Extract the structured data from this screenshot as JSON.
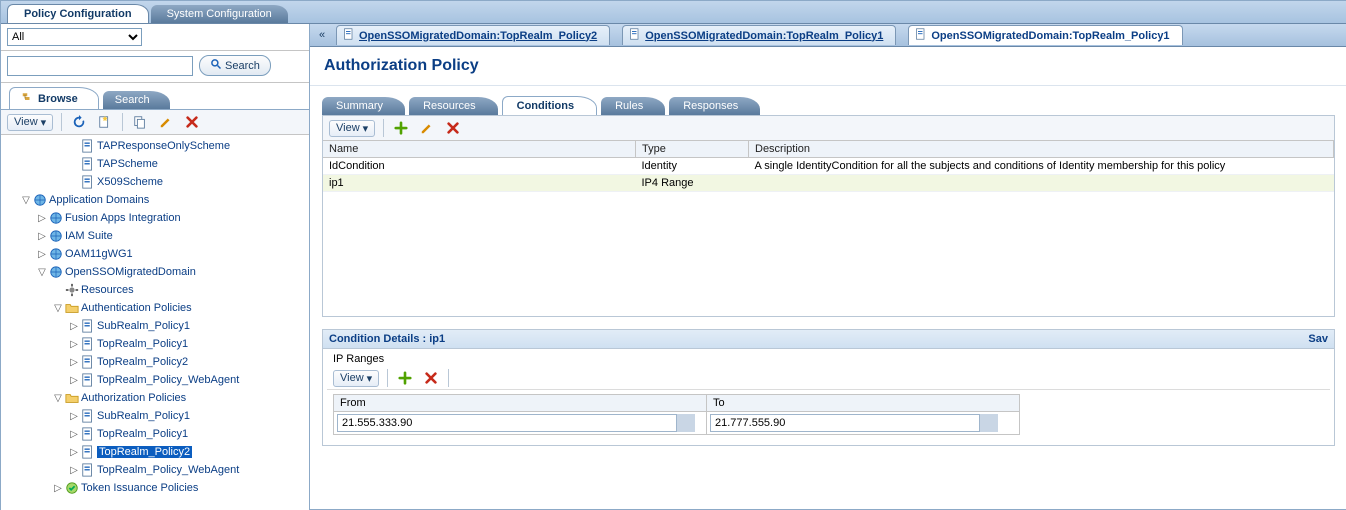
{
  "top_tabs": {
    "active": "Policy Configuration",
    "items": [
      "Policy Configuration",
      "System Configuration"
    ]
  },
  "left": {
    "all_select": "All",
    "search_btn": "Search",
    "browse_tab": "Browse",
    "search_tab": "Search",
    "view_label": "View"
  },
  "tree": [
    {
      "depth": 3,
      "toggle": "",
      "icon": "doc",
      "label": "TAPResponseOnlyScheme"
    },
    {
      "depth": 3,
      "toggle": "",
      "icon": "doc",
      "label": "TAPScheme"
    },
    {
      "depth": 3,
      "toggle": "",
      "icon": "doc",
      "label": "X509Scheme"
    },
    {
      "depth": 0,
      "toggle": "▽",
      "icon": "globe",
      "label": "Application Domains"
    },
    {
      "depth": 1,
      "toggle": "▷",
      "icon": "globe",
      "label": "Fusion Apps Integration"
    },
    {
      "depth": 1,
      "toggle": "▷",
      "icon": "globe",
      "label": "IAM Suite"
    },
    {
      "depth": 1,
      "toggle": "▷",
      "icon": "globe",
      "label": "OAM11gWG1"
    },
    {
      "depth": 1,
      "toggle": "▽",
      "icon": "globe",
      "label": "OpenSSOMigratedDomain"
    },
    {
      "depth": 2,
      "toggle": "",
      "icon": "gear",
      "label": "Resources"
    },
    {
      "depth": 2,
      "toggle": "▽",
      "icon": "folder",
      "label": "Authentication Policies"
    },
    {
      "depth": 3,
      "toggle": "▷",
      "icon": "doc",
      "label": "SubRealm_Policy1"
    },
    {
      "depth": 3,
      "toggle": "▷",
      "icon": "doc",
      "label": "TopRealm_Policy1"
    },
    {
      "depth": 3,
      "toggle": "▷",
      "icon": "doc",
      "label": "TopRealm_Policy2"
    },
    {
      "depth": 3,
      "toggle": "▷",
      "icon": "doc",
      "label": "TopRealm_Policy_WebAgent"
    },
    {
      "depth": 2,
      "toggle": "▽",
      "icon": "folder",
      "label": "Authorization Policies"
    },
    {
      "depth": 3,
      "toggle": "▷",
      "icon": "doc",
      "label": "SubRealm_Policy1"
    },
    {
      "depth": 3,
      "toggle": "▷",
      "icon": "doc",
      "label": "TopRealm_Policy1"
    },
    {
      "depth": 3,
      "toggle": "▷",
      "icon": "doc",
      "label": "TopRealm_Policy2",
      "selected": true
    },
    {
      "depth": 3,
      "toggle": "▷",
      "icon": "doc",
      "label": "TopRealm_Policy_WebAgent"
    },
    {
      "depth": 2,
      "toggle": "▷",
      "icon": "token",
      "label": "Token Issuance Policies"
    }
  ],
  "editor_tabs": [
    {
      "label": "OpenSSOMigratedDomain:TopRealm_Policy2",
      "active": false
    },
    {
      "label": "OpenSSOMigratedDomain:TopRealm_Policy1",
      "active": false
    },
    {
      "label": "OpenSSOMigratedDomain:TopRealm_Policy1",
      "active": true
    }
  ],
  "page": {
    "title": "Authorization Policy"
  },
  "inner_tabs": [
    "Summary",
    "Resources",
    "Conditions",
    "Rules",
    "Responses"
  ],
  "inner_active": "Conditions",
  "inner_view": "View",
  "cond_table": {
    "headers": [
      "Name",
      "Type",
      "Description"
    ],
    "rows": [
      {
        "name": "IdCondition",
        "type": "Identity",
        "desc": "A single IdentityCondition for all the subjects and conditions of Identity membership for this policy"
      },
      {
        "name": "ip1",
        "type": "IP4 Range",
        "desc": ""
      }
    ],
    "selected": 1
  },
  "details": {
    "title": "Condition Details : ip1",
    "save": "Sav",
    "ip_ranges_label": "IP Ranges",
    "view": "View",
    "headers": [
      "From",
      "To"
    ],
    "row": {
      "from": "21.555.333.90",
      "to": "21.777.555.90"
    }
  }
}
